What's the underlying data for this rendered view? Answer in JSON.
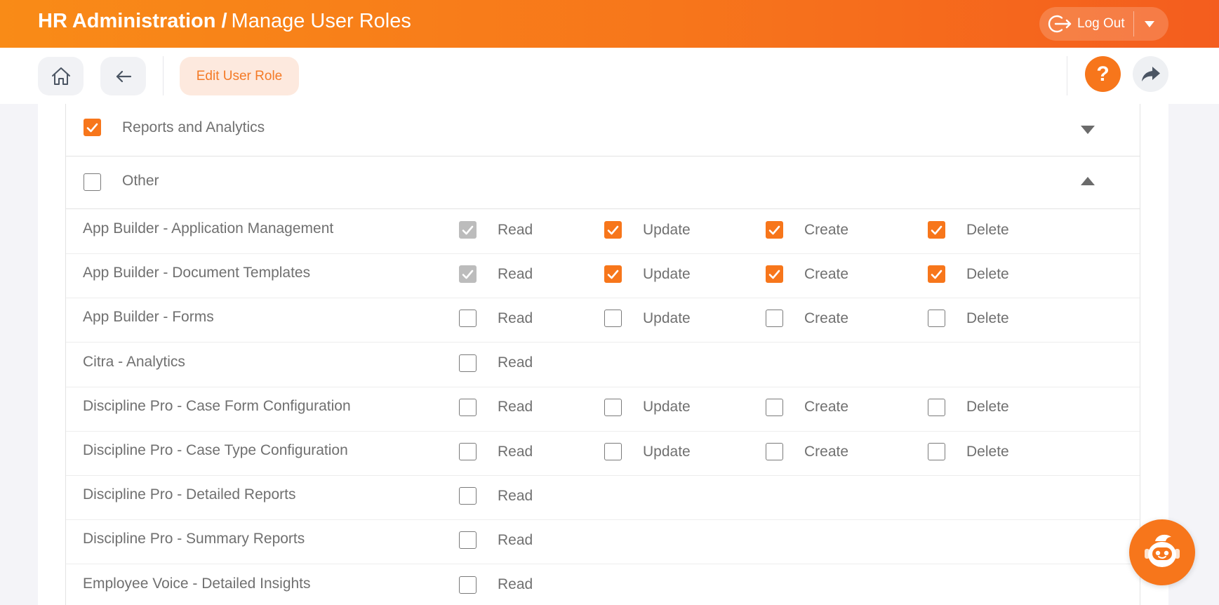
{
  "header": {
    "section": "HR Administration",
    "separator": "/",
    "page": "Manage User Roles",
    "logout_label": "Log Out"
  },
  "toolbar": {
    "edit_role_label": "Edit User Role",
    "help_glyph": "?"
  },
  "groups": {
    "reports": {
      "label": "Reports and Analytics",
      "checked": true,
      "expanded": false
    },
    "other": {
      "label": "Other",
      "checked": false,
      "expanded": true
    }
  },
  "permission_labels": {
    "read": "Read",
    "update": "Update",
    "create": "Create",
    "delete": "Delete"
  },
  "permissions": [
    {
      "name": "App Builder - Application Management",
      "read": "disabled",
      "update": "checked",
      "create": "checked",
      "delete": "checked"
    },
    {
      "name": "App Builder - Document Templates",
      "read": "disabled",
      "update": "checked",
      "create": "checked",
      "delete": "checked"
    },
    {
      "name": "App Builder - Forms",
      "read": "unchecked",
      "update": "unchecked",
      "create": "unchecked",
      "delete": "unchecked"
    },
    {
      "name": "Citra - Analytics",
      "read": "unchecked"
    },
    {
      "name": "Discipline Pro - Case Form Configuration",
      "read": "unchecked",
      "update": "unchecked",
      "create": "unchecked",
      "delete": "unchecked"
    },
    {
      "name": "Discipline Pro - Case Type Configuration",
      "read": "unchecked",
      "update": "unchecked",
      "create": "unchecked",
      "delete": "unchecked"
    },
    {
      "name": "Discipline Pro - Detailed Reports",
      "read": "unchecked"
    },
    {
      "name": "Discipline Pro - Summary Reports",
      "read": "unchecked"
    },
    {
      "name": "Employee Voice - Detailed Insights",
      "read": "unchecked"
    }
  ],
  "colors": {
    "accent": "#f7761b",
    "header_start": "#f98b17",
    "header_end": "#f45d1e",
    "disabled": "#bcbcbc"
  },
  "icons": [
    "logout-icon",
    "chevron-down-icon",
    "home-icon",
    "back-arrow-icon",
    "help-icon",
    "share-icon",
    "chevron-up-icon",
    "check-icon",
    "assistant-bot-icon"
  ]
}
